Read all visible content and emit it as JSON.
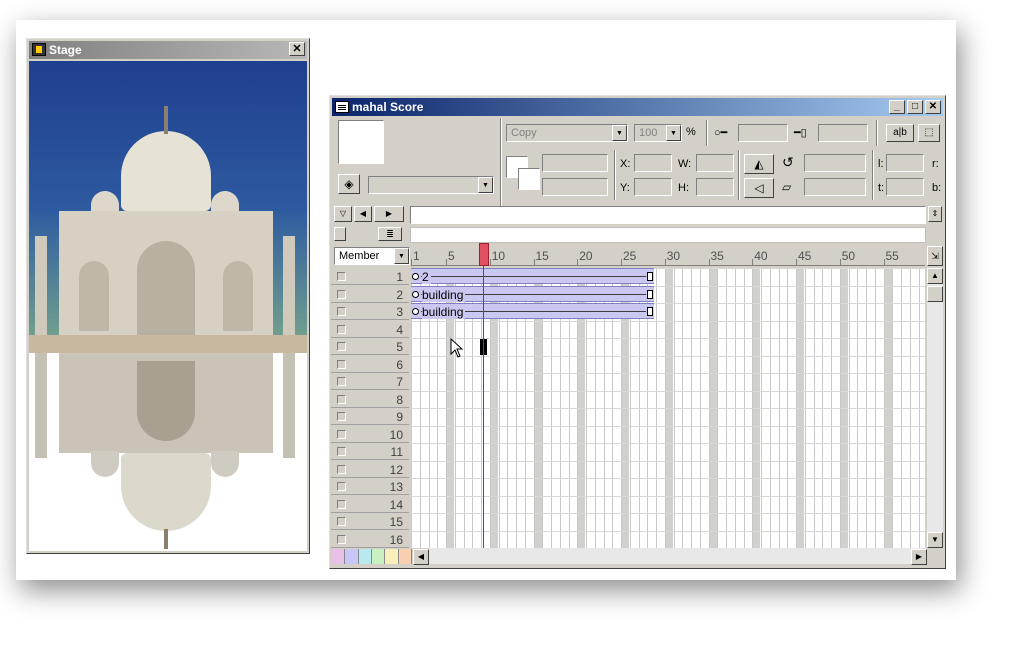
{
  "stage": {
    "title": "Stage",
    "close": "✕"
  },
  "score": {
    "title": "mahal Score",
    "controls": {
      "minimize": "_",
      "maximize": "□",
      "close": "✕"
    },
    "ink": {
      "value": "Copy"
    },
    "blend": {
      "value": "100",
      "unit": "%"
    },
    "labels": {
      "x": "X:",
      "y": "Y:",
      "w": "W:",
      "h": "H:",
      "l": "l:",
      "t": "t:",
      "r": "r:",
      "b": "b:"
    },
    "channel_dropdown": "Member",
    "ruler": [
      "1",
      "5",
      "10",
      "15",
      "20",
      "25",
      "30",
      "35",
      "40",
      "45",
      "50",
      "55"
    ],
    "channels": [
      "1",
      "2",
      "3",
      "4",
      "5",
      "6",
      "7",
      "8",
      "9",
      "10",
      "11",
      "12",
      "13",
      "14",
      "15",
      "16"
    ],
    "sprites": [
      {
        "channel": 1,
        "label": "2"
      },
      {
        "channel": 2,
        "label": "building"
      },
      {
        "channel": 3,
        "label": "building"
      }
    ]
  },
  "colors": {
    "score_title": "#0a246a",
    "sprite": "#c8c8f0",
    "playhead": "#e05060"
  }
}
